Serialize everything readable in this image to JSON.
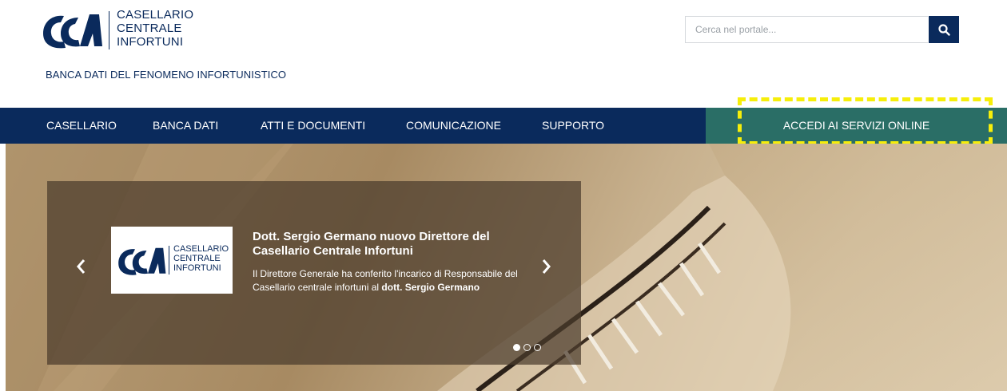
{
  "brand": {
    "lines": [
      "CASELLARIO",
      "CENTRALE",
      "INFORTUNI"
    ],
    "tagline": "BANCA DATI DEL FENOMENO INFORTUNISTICO",
    "color": "#0a2a5c"
  },
  "search": {
    "placeholder": "Cerca nel portale...",
    "value": "",
    "icon": "search-icon"
  },
  "nav": {
    "items": [
      {
        "label": "CASELLARIO"
      },
      {
        "label": "BANCA DATI"
      },
      {
        "label": "ATTI E DOCUMENTI"
      },
      {
        "label": "COMUNICAZIONE"
      },
      {
        "label": "SUPPORTO"
      }
    ],
    "cta_label": "ACCEDI AI SERVIZI ONLINE",
    "bar_color": "#0a2a5c",
    "cta_color": "#2a6e66",
    "highlight_color": "#f6ee0a"
  },
  "slider": {
    "slide": {
      "logo_lines": [
        "CASELLARIO",
        "CENTRALE",
        "INFORTUNI"
      ],
      "title": "Dott. Sergio Germano nuovo Direttore del Casellario Centrale Infortuni",
      "body_prefix": "Il Direttore Generale ha conferito l'incarico di Responsabile del Casellario centrale infortuni al ",
      "body_bold": "dott. Sergio Germano"
    },
    "prev_icon": "chevron-left-icon",
    "next_icon": "chevron-right-icon",
    "total_slides": 3,
    "active_slide": 1
  }
}
